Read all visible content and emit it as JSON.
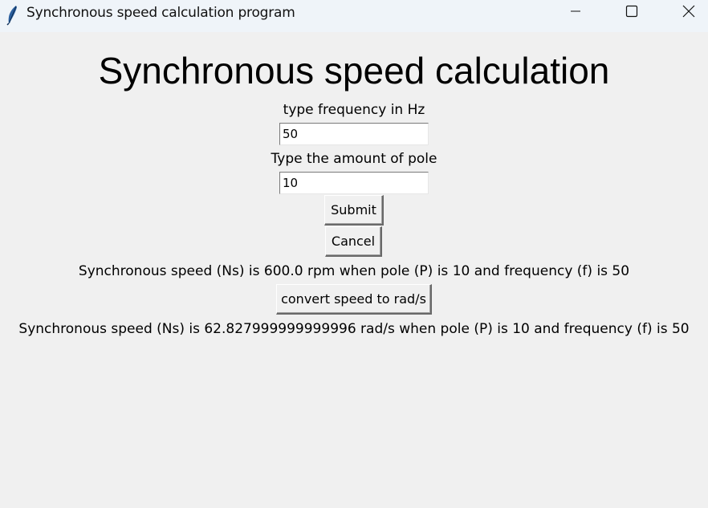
{
  "window": {
    "title": "Synchronous speed calculation program",
    "app_icon": "feather-icon",
    "controls": [
      "minimize-icon",
      "maximize-icon",
      "close-icon"
    ]
  },
  "main": {
    "heading": "Synchronous speed calculation",
    "frequency_label": "type frequency in Hz",
    "frequency_value": "50",
    "pole_label": "Type the amount of pole",
    "pole_value": "10",
    "submit_label": "Submit",
    "cancel_label": "Cancel",
    "rpm_result": "Synchronous speed (Ns) is 600.0 rpm when pole (P) is 10 and frequency (f) is 50",
    "convert_label": "convert speed to rad/s",
    "rads_result": "Synchronous speed (Ns) is 62.827999999999996 rad/s when pole (P) is 10 and frequency (f) is 50"
  }
}
